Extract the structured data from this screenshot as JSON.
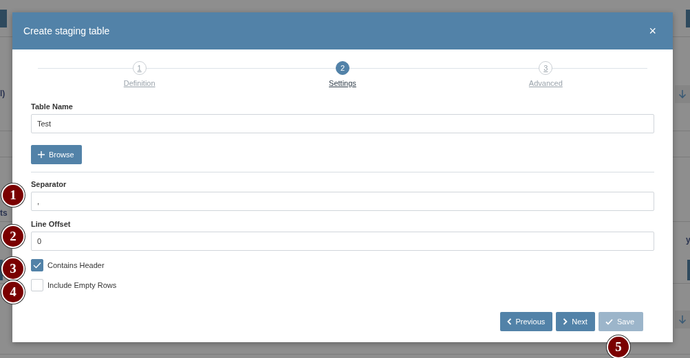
{
  "background": {
    "fragments": [
      "l)",
      "ts",
      "y"
    ]
  },
  "dialog": {
    "title": "Create staging table",
    "close": "×"
  },
  "steps": [
    {
      "number": "1",
      "label": "Definition",
      "selected": false
    },
    {
      "number": "2",
      "label": "Settings",
      "selected": true
    },
    {
      "number": "3",
      "label": "Advanced",
      "selected": false
    }
  ],
  "table_name": {
    "label": "Table Name",
    "value": "Test"
  },
  "browse_button": {
    "label": "Browse"
  },
  "settings": [
    {
      "kind": "text",
      "label": "Separator",
      "value": ",",
      "marker": "1"
    },
    {
      "kind": "text",
      "label": "Line Offset",
      "value": "0",
      "marker": "2"
    },
    {
      "kind": "checkbox",
      "label": "Contains Header",
      "checked": true,
      "marker": "3"
    },
    {
      "kind": "checkbox",
      "label": "Include Empty Rows",
      "checked": false,
      "marker": "4"
    }
  ],
  "buttons": [
    {
      "kind": "previous",
      "label": "Previous",
      "disabled": false
    },
    {
      "kind": "next",
      "label": "Next",
      "disabled": false
    },
    {
      "kind": "save",
      "label": "Save",
      "disabled": true,
      "marker": "5"
    }
  ]
}
